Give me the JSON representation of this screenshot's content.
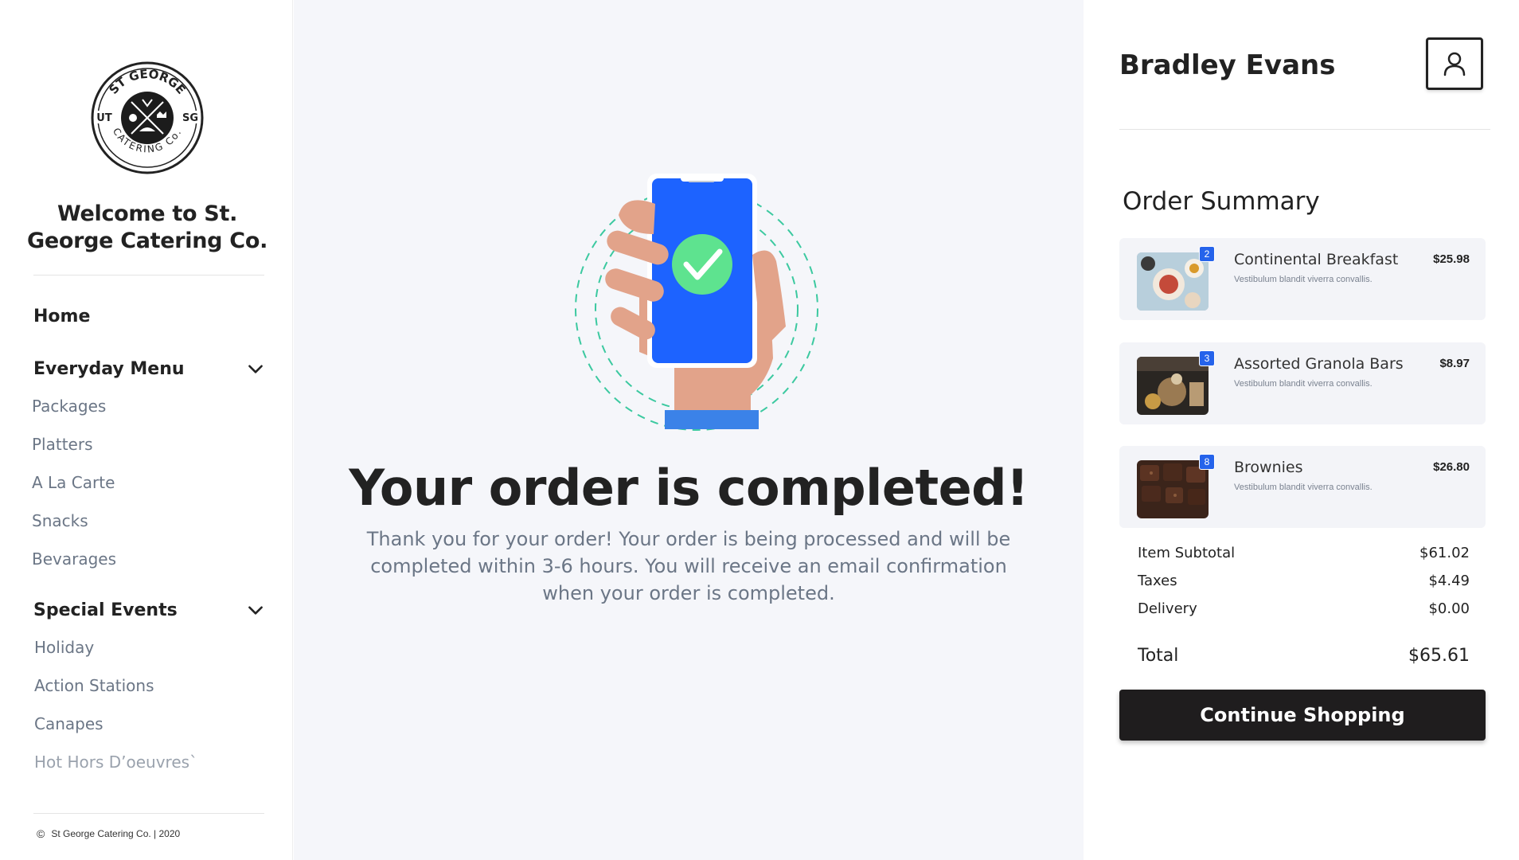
{
  "sidebar": {
    "logo": {
      "arc_top": "ST GEORGE",
      "arc_bottom": "CATERING Co.",
      "left_tag": "UT",
      "right_tag": "SG"
    },
    "welcome": "Welcome to St. George Catering Co.",
    "home": "Home",
    "sections": [
      {
        "label": "Everyday Menu",
        "items": [
          "Packages",
          "Platters",
          "A La Carte",
          "Snacks",
          "Bevarages"
        ]
      },
      {
        "label": "Special Events",
        "items": [
          "Holiday",
          "Action Stations",
          "Canapes",
          "Hot Hors D’oeuvres`"
        ]
      }
    ],
    "footer": "St George Catering Co. | 2020"
  },
  "main": {
    "headline": "Your order is completed!",
    "message": "Thank you for your order! Your order is being processed and will be completed within 3-6 hours. You will receive an email confirmation when your order is completed."
  },
  "right": {
    "user_name": "Bradley Evans",
    "summary_title": "Order Summary",
    "items": [
      {
        "name": "Continental Breakfast",
        "desc": "Vestibulum blandit viverra convallis.",
        "price": "$25.98",
        "qty": "2"
      },
      {
        "name": "Assorted Granola Bars",
        "desc": "Vestibulum blandit viverra convallis.",
        "price": "$8.97",
        "qty": "3"
      },
      {
        "name": "Brownies",
        "desc": "Vestibulum blandit viverra convallis.",
        "price": "$26.80",
        "qty": "8"
      }
    ],
    "totals": {
      "subtotal_label": "Item Subtotal",
      "subtotal": "$61.02",
      "taxes_label": "Taxes",
      "taxes": "$4.49",
      "delivery_label": "Delivery",
      "delivery": "$0.00",
      "total_label": "Total",
      "total": "$65.61"
    },
    "continue_label": "Continue Shopping"
  },
  "colors": {
    "accent_blue": "#2563eb",
    "check_green": "#5ee38f",
    "button_dark": "#1f1d1e",
    "main_bg": "#f5f6fa"
  },
  "icons": {
    "user": "user-icon",
    "chevron": "chevron-down-icon",
    "copyright": "copyright-icon",
    "check": "check-icon"
  }
}
